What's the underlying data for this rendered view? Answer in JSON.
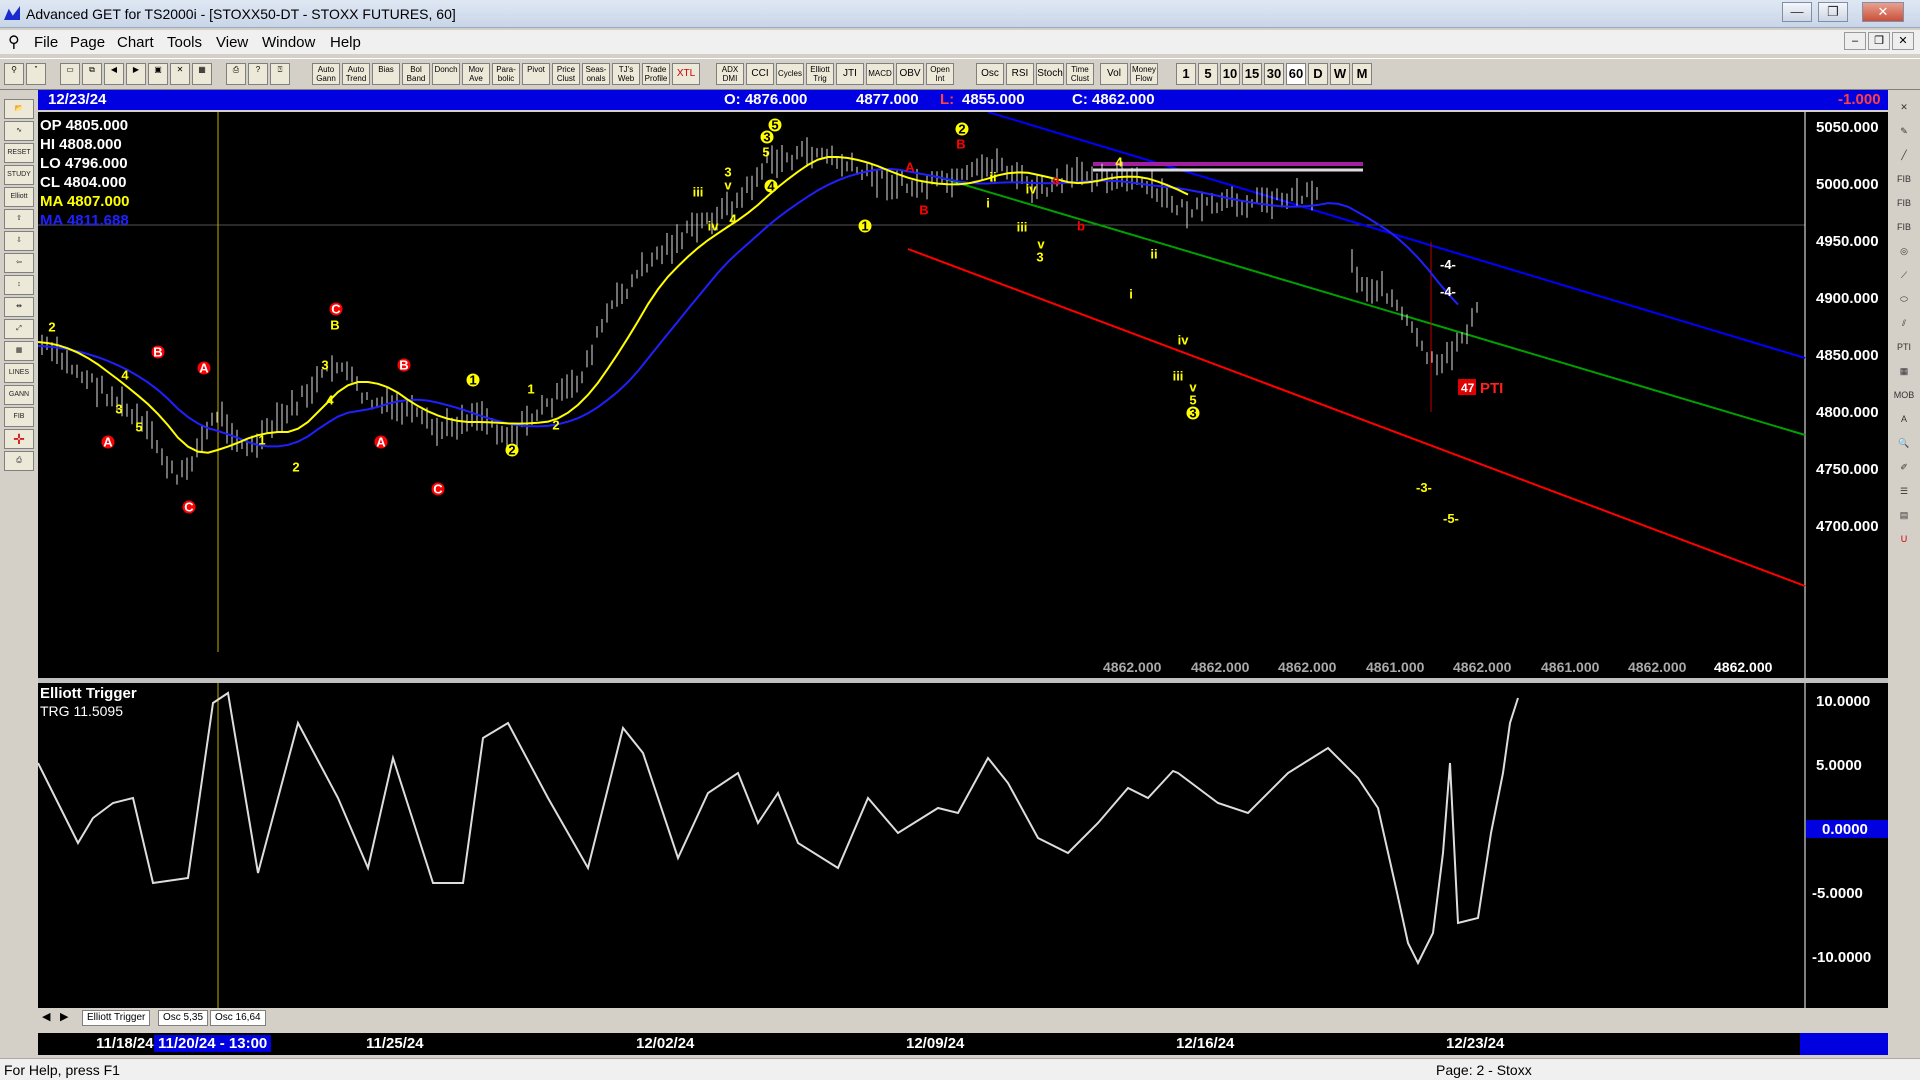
{
  "window": {
    "title": "Advanced GET for TS2000i - [STOXX50-DT - STOXX FUTURES, 60]"
  },
  "menu": [
    "File",
    "Page",
    "Chart",
    "Tools",
    "View",
    "Window",
    "Help"
  ],
  "toolbar": {
    "studies": [
      "Auto Gann",
      "Auto Trend",
      "Bias",
      "Bol Band",
      "Donch",
      "Mov Ave",
      "Para-bolic",
      "Pivot",
      "Price Clust",
      "Seas-onals",
      "TJ's Web",
      "Trade Profile",
      "XTL",
      "ADX DMI",
      "CCI",
      "Cycles",
      "Elliott Trig",
      "JTI",
      "MACD",
      "OBV",
      "Open Int",
      "Osc",
      "RSI",
      "Stoch",
      "Time Clust",
      "Vol",
      "Money Flow"
    ],
    "periods": [
      "1",
      "5",
      "10",
      "15",
      "30",
      "60",
      "D",
      "W",
      "M"
    ],
    "selected_period": "60"
  },
  "header": {
    "date": "12/23/24",
    "open": "O: 4876.000",
    "high": "4877.000",
    "low_label": "L:",
    "low": "4855.000",
    "close": "C: 4862.000",
    "change": "-1.000"
  },
  "ohlc": {
    "op": "OP  4805.000",
    "hi": "HI   4808.000",
    "lo": "LO  4796.000",
    "cl": "CL  4804.000",
    "ma": "MA  4807.000",
    "ma2": "MA  4811.688"
  },
  "price_axis": [
    "5050.000",
    "5000.000",
    "4950.000",
    "4900.000",
    "4850.000",
    "4800.000",
    "4750.000",
    "4700.000"
  ],
  "bottom_prices": [
    "4862.000",
    "4862.000",
    "4862.000",
    "4861.000",
    "4862.000",
    "4861.000",
    "4862.000",
    "4862.000"
  ],
  "pti": {
    "value": "47",
    "label": "PTI"
  },
  "projections": [
    "-4-",
    "-4-",
    "-3-",
    "-5-"
  ],
  "oscillator": {
    "title": "Elliott Trigger",
    "value": "TRG 11.5095",
    "axis": [
      "10.0000",
      "5.0000",
      "0.0000",
      "-5.0000",
      "-10.0000"
    ]
  },
  "tabs": [
    "Elliott Trigger",
    "Osc 5,35",
    "Osc 16,64"
  ],
  "dates": [
    "11/18/24",
    "11/20/24 - 13:00",
    "11/25/24",
    "12/02/24",
    "12/09/24",
    "12/16/24",
    "12/23/24"
  ],
  "status": {
    "left": "For Help, press F1",
    "right": "Page: 2 - Stoxx"
  },
  "colors": {
    "header_bg": "#0000e0",
    "ma_fast": "#ffff00",
    "ma_slow": "#2020ff",
    "trend_red": "#ff0000",
    "trend_green": "#00a000",
    "trend_blue": "#0000ff"
  }
}
